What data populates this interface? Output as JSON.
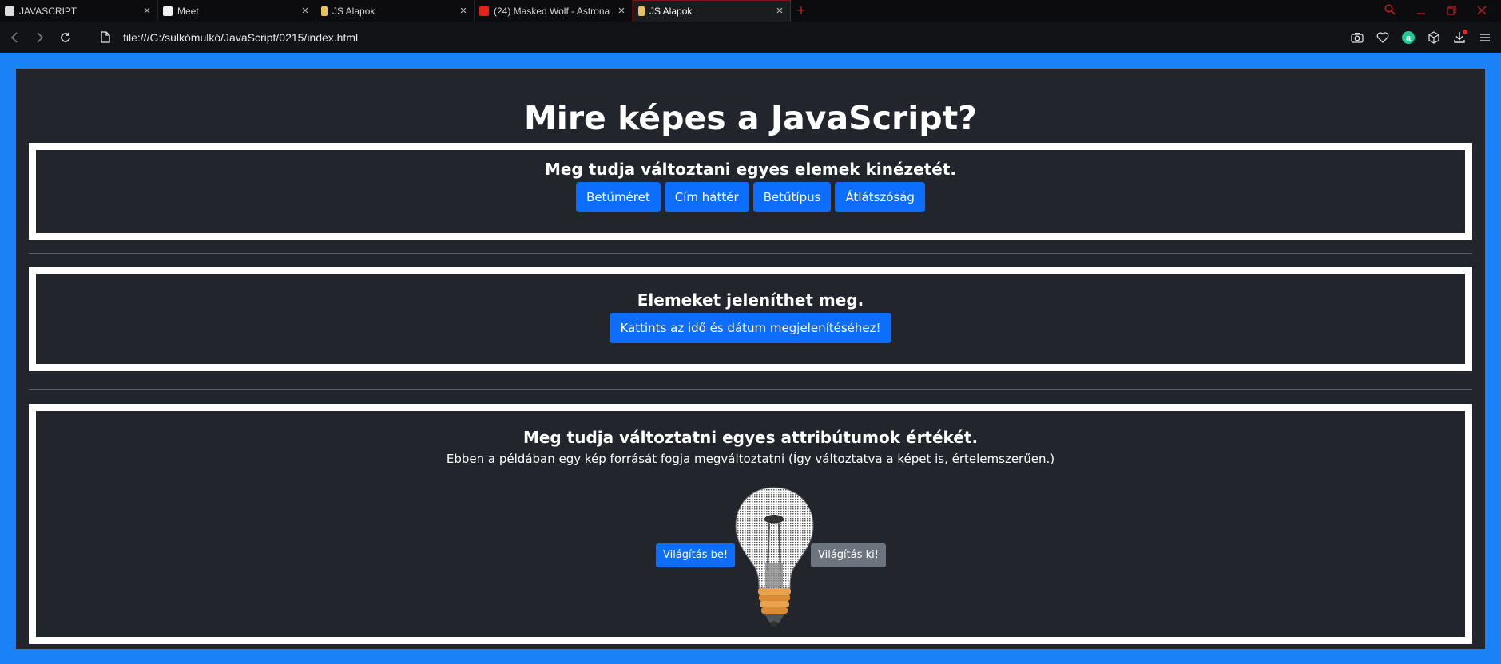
{
  "browser": {
    "tabs": [
      {
        "label": "JAVASCRIPT",
        "icon": "profile-icon",
        "active": false
      },
      {
        "label": "Meet",
        "icon": "doc-icon",
        "active": false
      },
      {
        "label": "JS Alapok",
        "icon": "js-file-icon",
        "active": false
      },
      {
        "label": "(24) Masked Wolf - Astrona",
        "icon": "youtube-icon",
        "active": false
      },
      {
        "label": "JS Alapok",
        "icon": "js-file-icon",
        "active": true
      }
    ],
    "new_tab": "+",
    "url": "file:///G:/sulkómulkó/JavaScript/0215/index.html"
  },
  "page": {
    "heading": "Mire képes a JavaScript?",
    "section1": {
      "heading": "Meg tudja változtani egyes elemek kinézetét.",
      "buttons": [
        "Betűméret",
        "Cím háttér",
        "Betűtípus",
        "Átlátszóság"
      ]
    },
    "section2": {
      "heading": "Elemeket jeleníthet meg.",
      "button": "Kattints az idő és dátum megjelenítéséhez!"
    },
    "section3": {
      "heading": "Meg tudja változtatni egyes attribútumok értékét.",
      "description": "Ebben a példában egy kép forrását fogja megváltoztatni (Így változtatva a képet is, értelemszerűen.)",
      "on_button": "Világítás be!",
      "off_button": "Világítás ki!",
      "image": "light-bulb-off"
    }
  },
  "colors": {
    "page_background": "#1a82f6",
    "container": "#22252c",
    "primary_button": "#0d6efd",
    "secondary_button": "#6c757d"
  }
}
